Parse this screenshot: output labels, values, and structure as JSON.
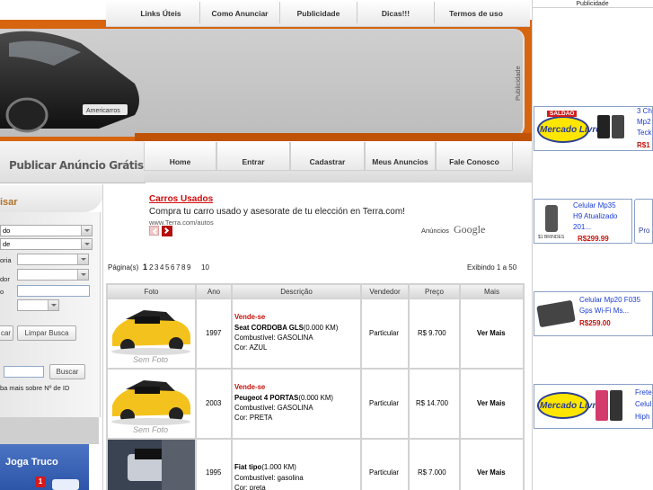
{
  "top_nav": [
    "Links Úteis",
    "Como Anunciar",
    "Publicidade",
    "Dicas!!!",
    "Termos de uso"
  ],
  "banner": {
    "side_label": "Publicidade",
    "car_plate": "Americarros"
  },
  "publicar_label": "Publicar Anúncio Grátis",
  "sub_nav": [
    "Home",
    "Entrar",
    "Cadastrar",
    "Meus Anuncios",
    "Fale Conosco"
  ],
  "sidebar": {
    "tab_label": "isar",
    "select_values": [
      "do",
      "de"
    ],
    "labels": [
      "oria",
      "dor",
      "o"
    ],
    "buttons": [
      "car",
      "Limpar Busca",
      "Buscar"
    ],
    "id_hint": "ba mais sobre Nº de ID",
    "game_title": "Joga Truco",
    "game_badge": "1"
  },
  "ad": {
    "title": "Carros Usados",
    "description": "Compra tu carro usado y asesorate de tu elección en Terra.com!",
    "url": "www.Terra.com/autos",
    "google_label": "Anúncios",
    "google_logo": "Google"
  },
  "pagination": {
    "label": "Página(s)",
    "pages": [
      "1",
      "2",
      "3",
      "4",
      "5",
      "6",
      "7",
      "8",
      "9",
      "10"
    ],
    "current": "1",
    "summary": "Exibindo 1 a 50"
  },
  "table": {
    "headers": [
      "Foto",
      "Ano",
      "Descrição",
      "Vendedor",
      "Preço",
      "Mais"
    ],
    "rows": [
      {
        "photo_note": "Sem Foto",
        "year": "1997",
        "tag": "Vende-se",
        "title": "Seat CORDOBA GLS",
        "km": "(0.000 KM)",
        "fuel": "Combustível: GASOLINA",
        "color": "Cor: AZUL",
        "seller": "Particular",
        "price": "R$ 9.700",
        "more": "Ver Mais"
      },
      {
        "photo_note": "Sem Foto",
        "year": "2003",
        "tag": "Vende-se",
        "title": "Peugeot 4 PORTAS",
        "km": "(0.000 KM)",
        "fuel": "Combustível: GASOLINA",
        "color": "Cor: PRETA",
        "seller": "Particular",
        "price": "R$ 14.700",
        "more": "Ver Mais"
      },
      {
        "photo_note": "",
        "year": "1995",
        "tag": "",
        "title": "Fiat tipo",
        "km": "(1.000 KM)",
        "fuel": "Combustível: gasolina",
        "color": "Cor: preta",
        "seller": "Particular",
        "price": "R$ 7.000",
        "more": "Ver Mais"
      }
    ]
  },
  "right_ads": {
    "header": "Publicidade",
    "ads": [
      {
        "logo": "Mercado Livre",
        "badge": "SALDÃO",
        "lines": [
          "3 Ch",
          "Mp2",
          "Teck"
        ],
        "price": "R$1"
      },
      {
        "lines": [
          "Celular Mp35",
          "H9 Atualizado",
          "201..."
        ],
        "price": "R$299.99",
        "caption": "$1 BRINDES",
        "next": "Pro"
      },
      {
        "lines": [
          "Celular Mp20 F035",
          "Gps Wi-Fi Ms..."
        ],
        "price": "R$259.00"
      },
      {
        "logo": "Mercado Livre",
        "lines": [
          "Frete",
          "Celul",
          "Hiph"
        ]
      }
    ]
  }
}
